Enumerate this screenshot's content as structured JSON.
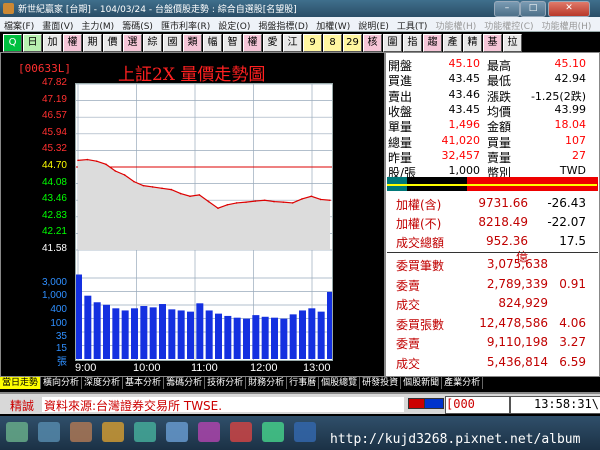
{
  "window": {
    "title": "新世紀贏家 [台期] - 104/03/24 - 台盤價股走勢 : 綜合自選股[名望股]"
  },
  "menu": [
    "檔案(F)",
    "畫面(V)",
    "主力(M)",
    "籌碼(S)",
    "匯市利率(R)",
    "設定(O)",
    "揭盤指標(D)",
    "加權(W)",
    "說明(E)",
    "工具(T)",
    "功能權(H)",
    "功能權控(C)",
    "功能權用(H)"
  ],
  "toolbar": [
    "Q",
    "日",
    "加",
    "權",
    "期",
    "價",
    "選",
    "綜",
    "國",
    "類",
    "幅",
    "智",
    "權",
    "愛",
    "江",
    "9",
    "8",
    "29",
    "核",
    "圍",
    "指",
    "趨",
    "產",
    "精",
    "基",
    "拉"
  ],
  "chart": {
    "code": "[00633L]",
    "title": "上証2X  量價走勢圖",
    "price_ticks": [
      "47.82",
      "47.19",
      "46.57",
      "45.94",
      "45.32",
      "44.70",
      "44.08",
      "43.46",
      "42.83",
      "42.21",
      "41.58"
    ],
    "ref_price": "44.70",
    "volume_ticks": [
      "3,000",
      "1,000",
      "400",
      "100",
      "35",
      "15"
    ],
    "volume_unit": "張",
    "time_labels": [
      "9:00",
      "10:00",
      "11:00",
      "12:00",
      "13:00"
    ]
  },
  "chart_data": {
    "type": "line",
    "x_label": "time",
    "ylim": [
      41.58,
      47.82
    ],
    "times": [
      "9:00",
      "9:10",
      "9:20",
      "9:30",
      "9:40",
      "9:50",
      "10:00",
      "10:10",
      "10:20",
      "10:30",
      "10:40",
      "10:50",
      "11:00",
      "11:10",
      "11:20",
      "11:30",
      "11:40",
      "11:50",
      "12:00",
      "12:10",
      "12:20",
      "12:30",
      "12:40",
      "12:50",
      "13:00",
      "13:10",
      "13:20",
      "13:30"
    ],
    "price": [
      44.95,
      44.98,
      44.92,
      44.8,
      44.55,
      44.4,
      44.15,
      44.0,
      43.95,
      43.9,
      43.85,
      43.7,
      43.6,
      43.65,
      43.4,
      43.15,
      43.28,
      43.35,
      43.38,
      43.42,
      43.45,
      43.4,
      43.38,
      43.35,
      43.5,
      43.6,
      43.48,
      43.45
    ],
    "volume": [
      2900,
      700,
      450,
      380,
      300,
      260,
      300,
      350,
      320,
      400,
      280,
      260,
      240,
      420,
      260,
      210,
      180,
      160,
      150,
      190,
      170,
      160,
      150,
      200,
      260,
      300,
      240,
      900
    ]
  },
  "quote": {
    "rows": [
      {
        "l1": "開盤",
        "v1": "45.10",
        "c1": "#ff0000",
        "l2": "最高",
        "v2": "45.10",
        "c2": "#ff0000"
      },
      {
        "l1": "買進",
        "v1": "43.45",
        "c1": "#000000",
        "l2": "最低",
        "v2": "42.94",
        "c2": "#000000"
      },
      {
        "l1": "賣出",
        "v1": "43.46",
        "c1": "#000000",
        "l2": "漲跌",
        "v2": "-1.25(2跌)",
        "c2": "#000000"
      },
      {
        "l1": "收盤",
        "v1": "43.45",
        "c1": "#000000",
        "l2": "均價",
        "v2": "43.99",
        "c2": "#000000"
      },
      {
        "l1": "單量",
        "v1": "1,496",
        "c1": "#ff0000",
        "l2": "金額",
        "v2": "18.04",
        "c2": "#ff0000"
      },
      {
        "l1": "總量",
        "v1": "41,020",
        "c1": "#ff0000",
        "l2": "買量",
        "v2": "107",
        "c2": "#ff0000"
      },
      {
        "l1": "昨量",
        "v1": "32,457",
        "c1": "#ff0000",
        "l2": "賣量",
        "v2": "27",
        "c2": "#ff0000"
      },
      {
        "l1": "股/張",
        "v1": "1,000",
        "c1": "#000000",
        "l2": "幣別",
        "v2": "TWD",
        "c2": "#000000"
      }
    ],
    "index": [
      {
        "label": "加權(含)",
        "value": "9731.66",
        "change": "-26.43"
      },
      {
        "label": "加權(不)",
        "value": "8218.49",
        "change": "-22.07"
      },
      {
        "label": "成交總額",
        "value": "952.36億",
        "change": "17.5"
      }
    ],
    "stats": [
      {
        "label": "委買筆數",
        "value": "3,075,638",
        "extra": ""
      },
      {
        "label": "委賣",
        "value": "2,789,339",
        "extra": "0.91"
      },
      {
        "label": "成交",
        "value": "824,929",
        "extra": ""
      },
      {
        "label": "委買張數",
        "value": "12,478,586",
        "extra": "4.06"
      },
      {
        "label": "委賣",
        "value": "9,110,198",
        "extra": "3.27"
      },
      {
        "label": "成交",
        "value": "5,436,814",
        "extra": "6.59"
      }
    ]
  },
  "tabs": [
    "當日走勢",
    "橫向分析",
    "深度分析",
    "基本分析",
    "籌碼分析",
    "技術分析",
    "財務分析",
    "行事曆",
    "個股總覽",
    "研發投資",
    "個股新聞",
    "產業分析"
  ],
  "status": {
    "label": "精誠",
    "message": "資料來源:台灣證券交易所 TWSE.",
    "box": "[000",
    "time": "13:58:31\\"
  },
  "watermark": "http://kujd3268.pixnet.net/album"
}
